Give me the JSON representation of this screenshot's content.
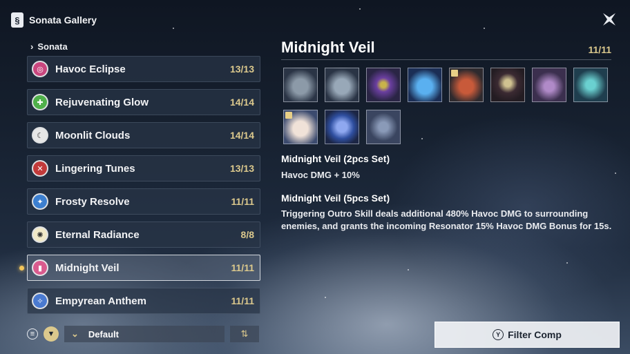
{
  "window": {
    "title": "Sonata Gallery"
  },
  "breadcrumb": {
    "label": "Sonata"
  },
  "sonatas": [
    {
      "name": "Havoc Eclipse",
      "count": "13/13",
      "icon": "havoc-eclipse-icon",
      "color": "#c9467e"
    },
    {
      "name": "Rejuvenating Glow",
      "count": "14/14",
      "icon": "rejuvenating-glow-icon",
      "color": "#4fb04a"
    },
    {
      "name": "Moonlit Clouds",
      "count": "14/14",
      "icon": "moonlit-clouds-icon",
      "color": "#e6e6e6"
    },
    {
      "name": "Lingering Tunes",
      "count": "13/13",
      "icon": "lingering-tunes-icon",
      "color": "#c23a3a"
    },
    {
      "name": "Frosty Resolve",
      "count": "11/11",
      "icon": "frosty-resolve-icon",
      "color": "#3c7fd0"
    },
    {
      "name": "Eternal Radiance",
      "count": "8/8",
      "icon": "eternal-radiance-icon",
      "color": "#f1e9c8"
    },
    {
      "name": "Midnight Veil",
      "count": "11/11",
      "icon": "midnight-veil-icon",
      "color": "#d95b8e"
    },
    {
      "name": "Empyrean Anthem",
      "count": "11/11",
      "icon": "empyrean-anthem-icon",
      "color": "#4a7ad0"
    }
  ],
  "controls": {
    "sort_value": "Default"
  },
  "detail": {
    "title": "Midnight Veil",
    "count": "11/11",
    "echoes": [
      {
        "name": "echo-1",
        "color": "#5a6a78"
      },
      {
        "name": "echo-2",
        "color": "#6b7a8c"
      },
      {
        "name": "echo-3",
        "color": "#6b3fa0"
      },
      {
        "name": "echo-4",
        "color": "#2f78c8"
      },
      {
        "name": "echo-5",
        "color": "#a8402f"
      },
      {
        "name": "echo-6",
        "color": "#3b2a32"
      },
      {
        "name": "echo-7",
        "color": "#5b4a6e"
      },
      {
        "name": "echo-8",
        "color": "#2f6f7c"
      },
      {
        "name": "echo-9",
        "color": "#e9d6d0"
      },
      {
        "name": "echo-10",
        "color": "#3f5fb0"
      },
      {
        "name": "echo-11",
        "color": "#4a5568"
      }
    ],
    "bonus2_title": "Midnight Veil (2pcs Set)",
    "bonus2_desc": "Havoc DMG + 10%",
    "bonus5_title": "Midnight Veil (5pcs Set)",
    "bonus5_desc": "Triggering Outro Skill deals additional 480% Havoc DMG to surrounding enemies, and grants the incoming Resonator 15% Havoc DMG Bonus for 15s."
  },
  "filter_button": {
    "key": "Y",
    "label": "Filter Comp"
  }
}
